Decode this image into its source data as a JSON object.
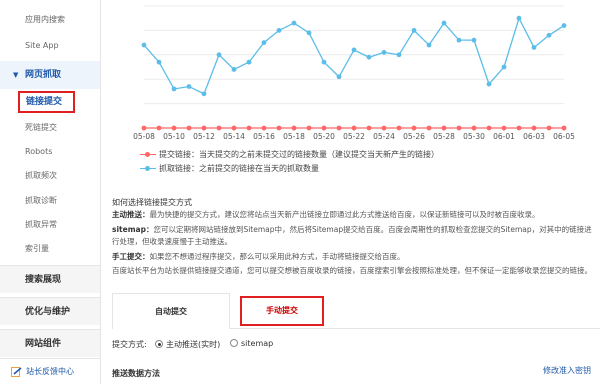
{
  "sidebar": {
    "items_top": [
      {
        "label": "应用内搜索"
      },
      {
        "label": "Site App"
      }
    ],
    "active_section": "网页抓取",
    "active_item": "链接提交",
    "sub_items": [
      {
        "label": "死链提交"
      },
      {
        "label": "Robots"
      },
      {
        "label": "抓取频次"
      },
      {
        "label": "抓取诊断"
      },
      {
        "label": "抓取异常"
      },
      {
        "label": "索引量"
      }
    ],
    "sections": [
      {
        "label": "搜索展现"
      },
      {
        "label": "优化与维护"
      },
      {
        "label": "网站组件"
      }
    ],
    "footer": "站长反馈中心"
  },
  "chart_data": {
    "type": "line",
    "x": [
      "05-08",
      "05-09",
      "05-10",
      "05-11",
      "05-12",
      "05-13",
      "05-14",
      "05-15",
      "05-16",
      "05-17",
      "05-18",
      "05-19",
      "05-20",
      "05-21",
      "05-22",
      "05-23",
      "05-24",
      "05-25",
      "05-26",
      "05-27",
      "05-28",
      "05-29",
      "05-30",
      "05-31",
      "06-01",
      "06-02",
      "06-03",
      "06-04",
      "06-05"
    ],
    "x_tick_labels": [
      "05-08",
      "05-10",
      "05-12",
      "05-14",
      "05-16",
      "05-18",
      "05-20",
      "05-22",
      "05-24",
      "05-26",
      "05-28",
      "05-30",
      "06-01",
      "06-03",
      "06-05"
    ],
    "series": [
      {
        "name": "提交链接：当天提交的之前未提交过的链接数量（建议提交当天新产生的链接）",
        "color": "#ff6666",
        "values": [
          0,
          0,
          0,
          0,
          0,
          0,
          0,
          0,
          0,
          0,
          0,
          0,
          0,
          0,
          0,
          0,
          0,
          0,
          0,
          0,
          0,
          0,
          0,
          0,
          0,
          0,
          0,
          0,
          0
        ]
      },
      {
        "name": "抓取链接：之前提交的链接在当天的抓取数量",
        "color": "#5bbde8",
        "values": [
          34,
          27,
          16,
          17,
          14,
          30,
          24,
          27,
          35,
          40,
          43,
          39,
          27,
          21,
          32,
          29,
          31,
          30,
          40,
          34,
          43,
          36,
          36,
          18,
          25,
          45,
          33,
          38,
          42
        ]
      }
    ],
    "ylim": [
      0,
      50
    ],
    "grid": "horizontal",
    "legend": "bottom"
  },
  "colors": {
    "accent": "#1d57a8",
    "highlight": "#e02020",
    "pushed": "#ff6666",
    "crawled": "#5bbde8"
  },
  "content": {
    "how_title": "如何选择链接提交方式",
    "p1_label": "主动推送：",
    "p1": "最为快捷的提交方式，建议您将站点当天新产出链接立即通过此方式推送给百度，以保证新链接可以及时被百度收录。",
    "p2_label": "sitemap：",
    "p2": "您可以定期将网站链接放到Sitemap中，然后将Sitemap提交给百度。百度会周期性的抓取检查您提交的Sitemap，对其中的链接进行处理，但收录速度慢于主动推送。",
    "p3_label": "手工提交：",
    "p3": "如果您不想通过程序提交，那么可以采用此种方式，手动将链接提交给百度。",
    "p4": "百度站长平台为站长提供链接提交通道，您可以提交想被百度收录的链接，百度搜索引擎会按照标准处理，但不保证一定能够收录您提交的链接。",
    "tab_auto": "自动提交",
    "tab_manual": "手动提交",
    "method_label": "提交方式:",
    "opt_active": "主动推送(实时)",
    "opt_sitemap": "sitemap",
    "push_title": "推送数据方法",
    "modify_link": "修改准入密钥"
  }
}
